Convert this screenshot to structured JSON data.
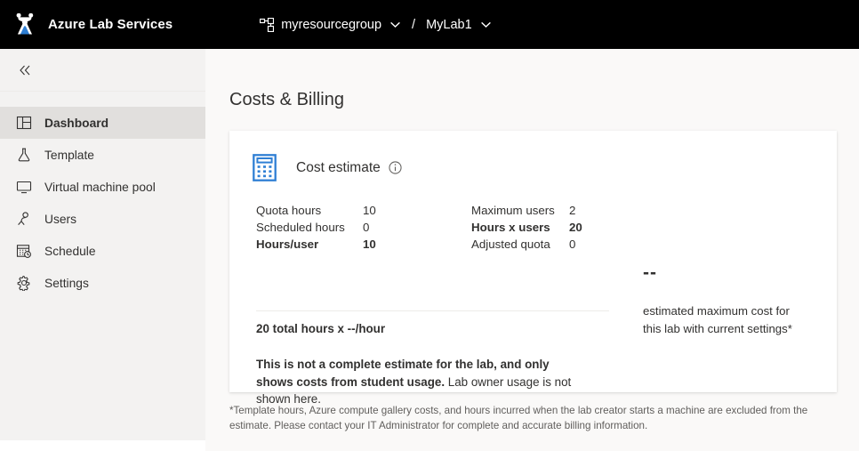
{
  "topbar": {
    "logo_icon": "azure-lab-flask-logo",
    "brand": "Azure Lab Services",
    "breadcrumb": {
      "resource_group_icon": "resource-group-icon",
      "resource_group": "myresourcegroup",
      "separator": "/",
      "lab": "MyLab1",
      "chevron_icon": "chevron-down-icon"
    }
  },
  "sidebar": {
    "collapse_icon": "double-chevron-left-icon",
    "items": [
      {
        "label": "Dashboard",
        "icon": "dashboard-grid-icon",
        "active": true
      },
      {
        "label": "Template",
        "icon": "flask-icon",
        "active": false
      },
      {
        "label": "Virtual machine pool",
        "icon": "monitor-icon",
        "active": false
      },
      {
        "label": "Users",
        "icon": "person-icon",
        "active": false
      },
      {
        "label": "Schedule",
        "icon": "calendar-clock-icon",
        "active": false
      },
      {
        "label": "Settings",
        "icon": "gear-icon",
        "active": false
      }
    ]
  },
  "main": {
    "page_title": "Costs & Billing",
    "card": {
      "icon": "calculator-icon",
      "title": "Cost estimate",
      "info_icon": "info-circle-icon",
      "stats_left": [
        {
          "key": "Quota hours",
          "value": "10",
          "bold": false
        },
        {
          "key": "Scheduled hours",
          "value": "0",
          "bold": false
        },
        {
          "key": "Hours/user",
          "value": "10",
          "bold": true
        }
      ],
      "stats_right": [
        {
          "key": "Maximum users",
          "value": "2",
          "bold": false
        },
        {
          "key": "Hours x users",
          "value": "20",
          "bold": true
        },
        {
          "key": "Adjusted quota",
          "value": "0",
          "bold": false
        }
      ],
      "total_line": "20 total hours x --/hour",
      "note_bold": "This is not a complete estimate for the lab, and only shows costs from student usage.",
      "note_regular": " Lab owner usage is not shown here.",
      "cost_amount": "--",
      "cost_description": "estimated maximum cost for this lab with current settings*"
    },
    "footnote": "*Template hours, Azure compute gallery costs, and hours incurred when the lab creator starts a machine are excluded from the estimate. Please contact your IT Administrator for complete and accurate billing information."
  },
  "colors": {
    "topbar_bg": "#000000",
    "sidebar_bg": "#f3f2f1",
    "sidebar_active_bg": "#e1dfdd",
    "page_bg": "#faf9f8",
    "card_bg": "#ffffff",
    "accent_blue": "#0078d4",
    "text_primary": "#323130",
    "text_secondary": "#605e5c"
  }
}
